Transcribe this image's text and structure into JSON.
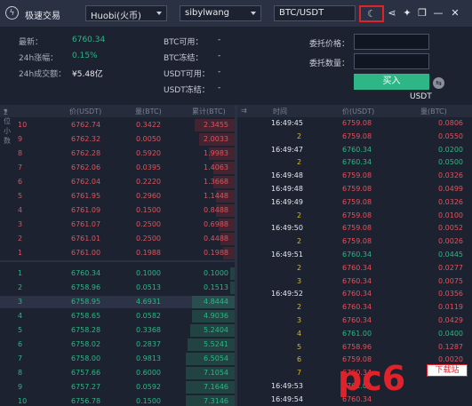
{
  "titlebar": {
    "app_title": "极速交易",
    "exchange": "Huobi(火币)",
    "account": "sibylwang",
    "pair": "BTC/USDT"
  },
  "stats": {
    "latest_label": "最新：",
    "latest_value": "6760.34",
    "change_label": "24h涨幅：",
    "change_value": "0.15%",
    "volume_label": "24h成交额：",
    "volume_value": "¥5.48亿"
  },
  "balances": [
    {
      "label": "BTC可用：",
      "value": "-"
    },
    {
      "label": "BTC冻结：",
      "value": "-"
    },
    {
      "label": "USDT可用：",
      "value": "-"
    },
    {
      "label": "USDT冻结：",
      "value": "-"
    }
  ],
  "order": {
    "price_label": "委托价格：",
    "price_value": "",
    "qty_label": "委托数量：",
    "qty_value": "",
    "buy_label": "买入",
    "unit": "USDT"
  },
  "book": {
    "headers": {
      "level": "2位小数",
      "price": "价(USDT)",
      "amount": "量(BTC)",
      "cum": "累计(BTC)"
    },
    "asks": [
      {
        "n": "10",
        "price": "6762.74",
        "amt": "0.3422",
        "cum": "2.3455",
        "depth": 0.17
      },
      {
        "n": "9",
        "price": "6762.32",
        "amt": "0.0050",
        "cum": "2.0033",
        "depth": 0.15
      },
      {
        "n": "8",
        "price": "6762.28",
        "amt": "0.5920",
        "cum": "1.9983",
        "depth": 0.11
      },
      {
        "n": "7",
        "price": "6762.06",
        "amt": "0.0395",
        "cum": "1.4063",
        "depth": 0.09
      },
      {
        "n": "6",
        "price": "6762.04",
        "amt": "0.2220",
        "cum": "1.3668",
        "depth": 0.09
      },
      {
        "n": "5",
        "price": "6761.95",
        "amt": "0.2960",
        "cum": "1.1448",
        "depth": 0.08
      },
      {
        "n": "4",
        "price": "6761.09",
        "amt": "0.1500",
        "cum": "0.8488",
        "depth": 0.08
      },
      {
        "n": "3",
        "price": "6761.07",
        "amt": "0.2500",
        "cum": "0.6988",
        "depth": 0.07
      },
      {
        "n": "2",
        "price": "6761.01",
        "amt": "0.2500",
        "cum": "0.4488",
        "depth": 0.06
      },
      {
        "n": "1",
        "price": "6761.00",
        "amt": "0.1988",
        "cum": "0.1988",
        "depth": 0.05
      }
    ],
    "bids": [
      {
        "n": "1",
        "price": "6760.34",
        "amt": "0.1000",
        "cum": "0.1000",
        "depth": 0.02
      },
      {
        "n": "2",
        "price": "6758.96",
        "amt": "0.0513",
        "cum": "0.1513",
        "depth": 0.02
      },
      {
        "n": "3",
        "price": "6758.95",
        "amt": "4.6931",
        "cum": "4.8444",
        "depth": 0.18
      },
      {
        "n": "4",
        "price": "6758.65",
        "amt": "0.0582",
        "cum": "4.9036",
        "depth": 0.18
      },
      {
        "n": "5",
        "price": "6758.28",
        "amt": "0.3368",
        "cum": "5.2404",
        "depth": 0.19
      },
      {
        "n": "6",
        "price": "6758.02",
        "amt": "0.2837",
        "cum": "5.5241",
        "depth": 0.2
      },
      {
        "n": "7",
        "price": "6758.00",
        "amt": "0.9813",
        "cum": "6.5054",
        "depth": 0.21
      },
      {
        "n": "8",
        "price": "6757.66",
        "amt": "0.6000",
        "cum": "7.1054",
        "depth": 0.21
      },
      {
        "n": "9",
        "price": "6757.27",
        "amt": "0.0592",
        "cum": "7.1646",
        "depth": 0.21
      },
      {
        "n": "10",
        "price": "6756.78",
        "amt": "0.1500",
        "cum": "7.3146",
        "depth": 0.21
      }
    ],
    "selected_bid_index": 2
  },
  "trades": {
    "headers": {
      "time": "时间",
      "price": "价(USDT)",
      "amount": "量(BTC)"
    },
    "rows": [
      {
        "time": "16:49:45",
        "price": "6759.08",
        "amt": "0.0806",
        "side": "sell"
      },
      {
        "time": "2",
        "price": "6759.08",
        "amt": "0.0550",
        "side": "sell"
      },
      {
        "time": "16:49:47",
        "price": "6760.34",
        "amt": "0.0200",
        "side": "buy"
      },
      {
        "time": "2",
        "price": "6760.34",
        "amt": "0.0500",
        "side": "buy"
      },
      {
        "time": "16:49:48",
        "price": "6759.08",
        "amt": "0.0326",
        "side": "sell"
      },
      {
        "time": "16:49:48",
        "price": "6759.08",
        "amt": "0.0499",
        "side": "sell"
      },
      {
        "time": "16:49:49",
        "price": "6759.08",
        "amt": "0.0326",
        "side": "sell"
      },
      {
        "time": "2",
        "price": "6759.08",
        "amt": "0.0100",
        "side": "sell"
      },
      {
        "time": "16:49:50",
        "price": "6759.08",
        "amt": "0.0052",
        "side": "sell"
      },
      {
        "time": "2",
        "price": "6759.08",
        "amt": "0.0026",
        "side": "sell"
      },
      {
        "time": "16:49:51",
        "price": "6760.34",
        "amt": "0.0445",
        "side": "buy"
      },
      {
        "time": "2",
        "price": "6760.34",
        "amt": "0.0277",
        "side": "sell"
      },
      {
        "time": "3",
        "price": "6760.34",
        "amt": "0.0075",
        "side": "sell"
      },
      {
        "time": "16:49:52",
        "price": "6760.34",
        "amt": "0.0356",
        "side": "sell"
      },
      {
        "time": "2",
        "price": "6760.34",
        "amt": "0.0119",
        "side": "sell"
      },
      {
        "time": "3",
        "price": "6760.34",
        "amt": "0.0429",
        "side": "sell"
      },
      {
        "time": "4",
        "price": "6761.00",
        "amt": "0.0400",
        "side": "buy"
      },
      {
        "time": "5",
        "price": "6758.96",
        "amt": "0.1287",
        "side": "sell"
      },
      {
        "time": "6",
        "price": "6759.08",
        "amt": "0.0020",
        "side": "sell"
      },
      {
        "time": "7",
        "price": "6760.34",
        "amt": "",
        "side": "sell"
      },
      {
        "time": "16:49:53",
        "price": "6761.00",
        "amt": "",
        "side": "buy"
      },
      {
        "time": "16:49:54",
        "price": "6760.34",
        "amt": "",
        "side": "sell"
      }
    ]
  },
  "watermark": {
    "text": "pc6",
    "badge": "下载站"
  },
  "colors": {
    "up": "#2fb686",
    "down": "#e2535c",
    "highlight": "#e0222a"
  }
}
